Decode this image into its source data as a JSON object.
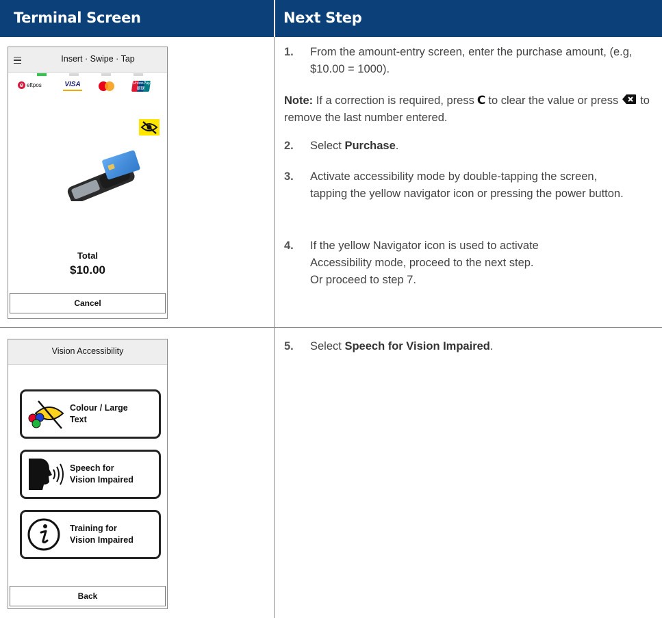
{
  "header": {
    "col1": "Terminal Screen",
    "col2": "Next Step"
  },
  "screen1": {
    "title": "Insert · Swipe · Tap",
    "card_logos": [
      "eftpos",
      "VISA",
      "mastercard",
      "UnionPay"
    ],
    "eftpos_label": "eftpos",
    "visa_label": "VISA",
    "unionpay_label": "UnionPay 银联",
    "total_label": "Total",
    "total_value": "$10.00",
    "button": "Cancel",
    "icons": [
      "menu-icon",
      "eye-crossed-icon",
      "terminal-card-image"
    ]
  },
  "screen2": {
    "title": "Vision Accessibility",
    "options": [
      {
        "line1": "Colour / Large",
        "line2": "Text",
        "icon": "colour-eye-icon"
      },
      {
        "line1": "Speech for",
        "line2": "Vision Impaired",
        "icon": "speaking-head-icon"
      },
      {
        "line1": "Training for",
        "line2": "Vision Impaired",
        "icon": "info-icon"
      }
    ],
    "button": "Back"
  },
  "steps": {
    "s1": {
      "num": "1.",
      "text": "From the amount-entry screen, enter the purchase amount, (e.g, $10.00 = 1000)."
    },
    "note": {
      "label": "Note:",
      "part1": "If a correction is required, press",
      "key": "C",
      "part2": "to clear the value or press",
      "part3": "to remove the last number entered."
    },
    "s2": {
      "num": "2.",
      "pre": "Select ",
      "bold": "Purchase",
      "post": "."
    },
    "s3": {
      "num": "3.",
      "text": "Activate accessibility mode by double-tapping the screen, tapping the yellow navigator icon or pressing the power button."
    },
    "s4": {
      "num": "4.",
      "line1": "If the yellow Navigator icon is used to activate Accessibility mode, proceed to the next step.",
      "line2": "Or proceed to step 7."
    },
    "s5": {
      "num": "5.",
      "pre": "Select ",
      "bold": "Speech for Vision Impaired",
      "post": "."
    }
  },
  "colors": {
    "header_bg": "#0b4178",
    "navigator_yellow": "#ffe600",
    "indicator_green": "#2ec84a"
  }
}
